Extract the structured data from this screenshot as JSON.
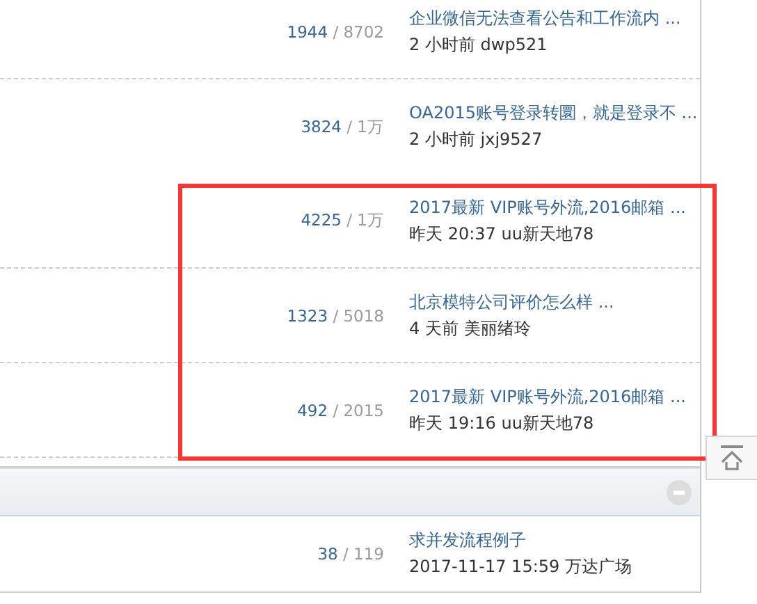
{
  "sections": [
    {
      "groups": [
        {
          "highlighted": false,
          "rows": [
            {
              "replies": "1944",
              "separator": "/",
              "views": "8702",
              "title": "企业微信无法查看公告和工作流内 ...",
              "meta": "2 小时前 dwp521"
            },
            {
              "replies": "3824",
              "separator": "/",
              "views": "1万",
              "title": "OA2015账号登录转圜，就是登录不 ...",
              "meta": "2 小时前 jxj9527"
            }
          ]
        },
        {
          "highlighted": true,
          "rows": [
            {
              "replies": "4225",
              "separator": "/",
              "views": "1万",
              "title": "2017最新 VIP账号外流,2016邮箱 ...",
              "meta": "昨天 20:37 uu新天地78"
            },
            {
              "replies": "1323",
              "separator": "/",
              "views": "5018",
              "title": "北京模特公司评价怎么样 ...",
              "meta": "4 天前 美丽绪玲"
            },
            {
              "replies": "492",
              "separator": "/",
              "views": "2015",
              "title": "2017最新 VIP账号外流,2016邮箱 ...",
              "meta": "昨天 19:16 uu新天地78"
            }
          ]
        }
      ]
    },
    {
      "expanded": true,
      "groups": [
        {
          "highlighted": false,
          "rows": [
            {
              "replies": "38",
              "separator": "/",
              "views": "119",
              "title": "求并发流程例子",
              "meta": "2017-11-17 15:59 万达广场"
            }
          ]
        }
      ]
    }
  ]
}
